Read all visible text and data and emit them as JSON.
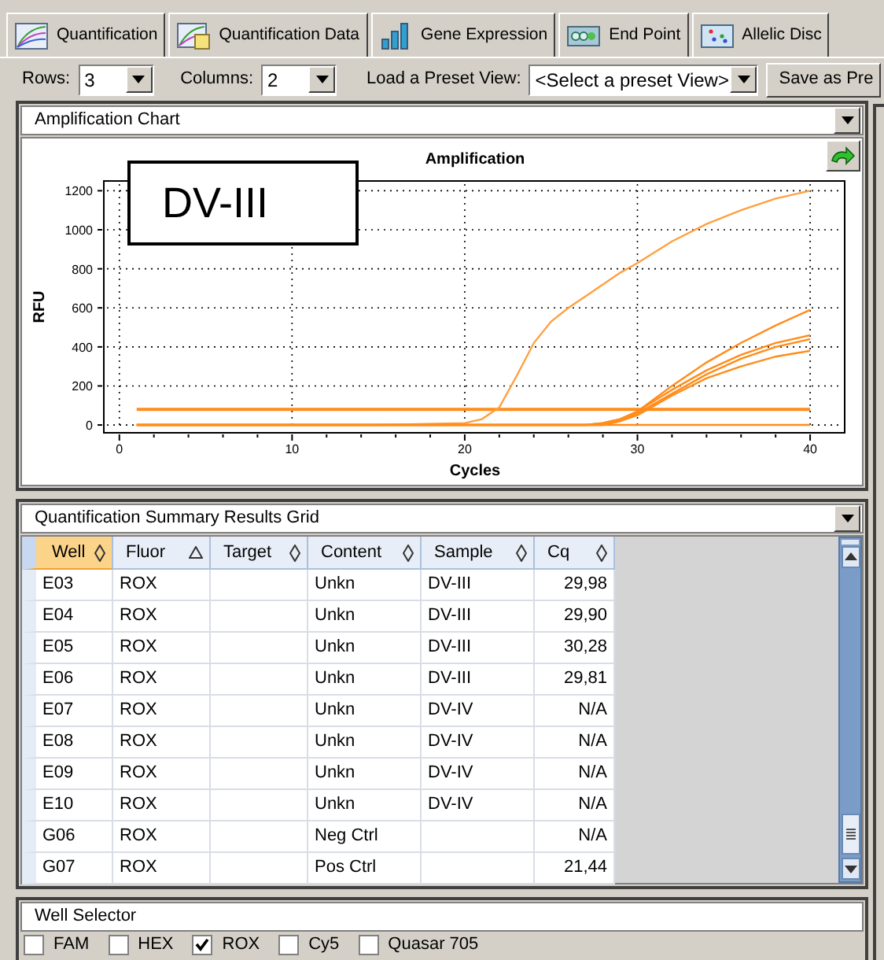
{
  "tabs": [
    {
      "label": "Quantification"
    },
    {
      "label": "Quantification Data"
    },
    {
      "label": "Gene Expression"
    },
    {
      "label": "End Point"
    },
    {
      "label": "Allelic Disc"
    }
  ],
  "toolbar": {
    "rows_label": "Rows:",
    "rows_value": "3",
    "columns_label": "Columns:",
    "columns_value": "2",
    "preset_label": "Load a Preset View:",
    "preset_value": "<Select a preset View>",
    "save_button": "Save as Pre"
  },
  "chart_panel": {
    "title": "Amplification Chart",
    "annotation": "DV-III",
    "chart_data": {
      "type": "line",
      "title": "Amplification",
      "xlabel": "Cycles",
      "ylabel": "RFU",
      "grid": true,
      "x": [
        1,
        5,
        10,
        15,
        20,
        21,
        22,
        23,
        24,
        25,
        26,
        27,
        28,
        29,
        30,
        32,
        34,
        36,
        38,
        40
      ],
      "xlim": [
        -0.9,
        42
      ],
      "ylim": [
        -40,
        1250
      ],
      "xticks": [
        0,
        10,
        20,
        30,
        40
      ],
      "yticks": [
        0,
        200,
        400,
        600,
        800,
        1000,
        1200
      ],
      "series": [
        {
          "color": "#ff8c1a",
          "values": [
            80,
            80,
            80,
            80,
            80,
            80,
            80,
            80,
            80,
            80,
            80,
            80,
            80,
            80,
            80,
            80,
            80,
            80,
            80,
            80
          ]
        },
        {
          "color": "#ffa040",
          "values": [
            0,
            0,
            0,
            0,
            10,
            30,
            90,
            250,
            420,
            530,
            600,
            660,
            720,
            780,
            830,
            940,
            1030,
            1100,
            1160,
            1200
          ]
        },
        {
          "color": "#ff8c1a",
          "values": [
            0,
            0,
            0,
            0,
            0,
            0,
            0,
            0,
            0,
            0,
            0,
            0,
            10,
            30,
            70,
            200,
            320,
            420,
            510,
            590
          ]
        },
        {
          "color": "#ff8c1a",
          "values": [
            0,
            0,
            0,
            0,
            0,
            0,
            0,
            0,
            0,
            0,
            0,
            0,
            10,
            30,
            70,
            180,
            280,
            360,
            420,
            460
          ]
        },
        {
          "color": "#ff8c1a",
          "values": [
            0,
            0,
            0,
            0,
            0,
            0,
            0,
            0,
            0,
            0,
            0,
            0,
            0,
            20,
            50,
            150,
            240,
            300,
            350,
            380
          ]
        },
        {
          "color": "#ff8c1a",
          "values": [
            0,
            0,
            0,
            0,
            0,
            0,
            0,
            0,
            0,
            0,
            0,
            0,
            0,
            20,
            60,
            160,
            260,
            340,
            400,
            440
          ]
        },
        {
          "color": "#ff8c1a",
          "values": [
            0,
            0,
            0,
            0,
            0,
            0,
            0,
            0,
            0,
            0,
            0,
            0,
            0,
            0,
            0,
            0,
            0,
            0,
            0,
            0
          ]
        }
      ]
    }
  },
  "grid_panel": {
    "title": "Quantification Summary Results Grid",
    "columns": [
      {
        "label": "Well",
        "sorted": false,
        "selected": true
      },
      {
        "label": "Fluor",
        "sorted": true,
        "selected": false
      },
      {
        "label": "Target",
        "sorted": false,
        "selected": false
      },
      {
        "label": "Content",
        "sorted": false,
        "selected": false
      },
      {
        "label": "Sample",
        "sorted": false,
        "selected": false
      },
      {
        "label": "Cq",
        "sorted": false,
        "selected": false
      }
    ],
    "rows": [
      [
        "E03",
        "ROX",
        "",
        "Unkn",
        "DV-III",
        "29,98"
      ],
      [
        "E04",
        "ROX",
        "",
        "Unkn",
        "DV-III",
        "29,90"
      ],
      [
        "E05",
        "ROX",
        "",
        "Unkn",
        "DV-III",
        "30,28"
      ],
      [
        "E06",
        "ROX",
        "",
        "Unkn",
        "DV-III",
        "29,81"
      ],
      [
        "E07",
        "ROX",
        "",
        "Unkn",
        "DV-IV",
        "N/A"
      ],
      [
        "E08",
        "ROX",
        "",
        "Unkn",
        "DV-IV",
        "N/A"
      ],
      [
        "E09",
        "ROX",
        "",
        "Unkn",
        "DV-IV",
        "N/A"
      ],
      [
        "E10",
        "ROX",
        "",
        "Unkn",
        "DV-IV",
        "N/A"
      ],
      [
        "G06",
        "ROX",
        "",
        "Neg Ctrl",
        "",
        "N/A"
      ],
      [
        "G07",
        "ROX",
        "",
        "Pos Ctrl",
        "",
        "21,44"
      ]
    ]
  },
  "well_selector": {
    "title": "Well Selector",
    "fluors": [
      {
        "label": "FAM",
        "checked": false
      },
      {
        "label": "HEX",
        "checked": false
      },
      {
        "label": "ROX",
        "checked": true
      },
      {
        "label": "Cy5",
        "checked": false
      },
      {
        "label": "Quasar 705",
        "checked": false
      }
    ]
  }
}
